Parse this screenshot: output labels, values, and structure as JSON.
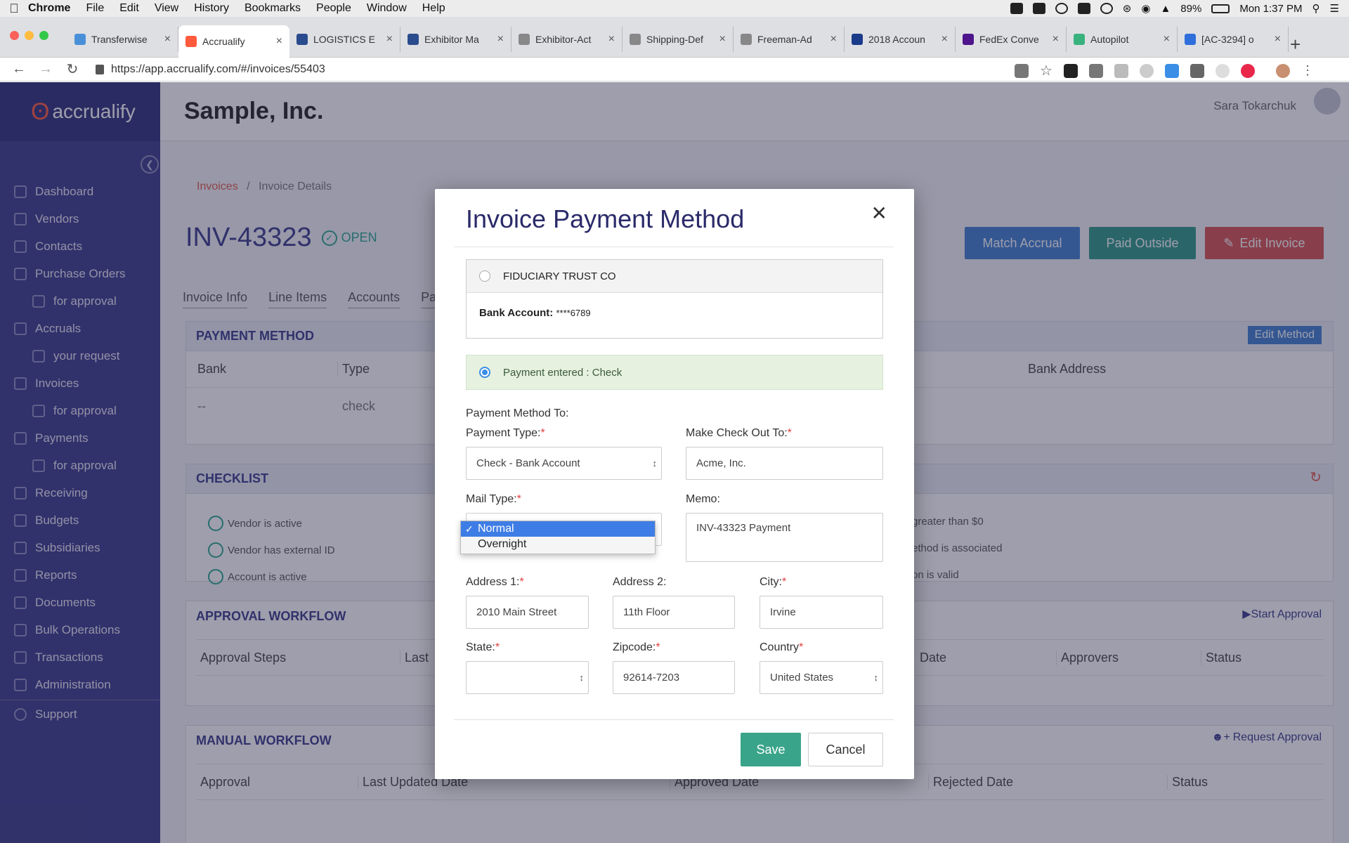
{
  "menubar": {
    "app": "Chrome",
    "items": [
      "File",
      "Edit",
      "View",
      "History",
      "Bookmarks",
      "People",
      "Window",
      "Help"
    ],
    "battery": "89%",
    "clock": "Mon 1:37 PM"
  },
  "browser": {
    "tabs": [
      {
        "title": "Transferwise",
        "color": "#4a90d9"
      },
      {
        "title": "Accrualify",
        "color": "#ff5a3c"
      },
      {
        "title": "LOGISTICS E",
        "color": "#2a4b8d"
      },
      {
        "title": "Exhibitor Ma",
        "color": "#2a4b8d"
      },
      {
        "title": "Exhibitor-Act",
        "color": "#888888"
      },
      {
        "title": "Shipping-Def",
        "color": "#888888"
      },
      {
        "title": "Freeman-Ad",
        "color": "#888888"
      },
      {
        "title": "2018 Accoun",
        "color": "#1a3a8a"
      },
      {
        "title": "FedEx Conve",
        "color": "#4d148c"
      },
      {
        "title": "Autopilot",
        "color": "#3ab27e"
      },
      {
        "title": "[AC-3294] o",
        "color": "#2e6fdb"
      }
    ],
    "url": "https://app.accrualify.com/#/invoices/55403"
  },
  "sidebar": {
    "logo": "accrualify",
    "items": [
      {
        "label": "Dashboard",
        "sub": false
      },
      {
        "label": "Vendors",
        "sub": false
      },
      {
        "label": "Contacts",
        "sub": false
      },
      {
        "label": "Purchase Orders",
        "sub": false
      },
      {
        "label": "for approval",
        "sub": true
      },
      {
        "label": "Accruals",
        "sub": false
      },
      {
        "label": "your request",
        "sub": true
      },
      {
        "label": "Invoices",
        "sub": false
      },
      {
        "label": "for approval",
        "sub": true
      },
      {
        "label": "Payments",
        "sub": false
      },
      {
        "label": "for approval",
        "sub": true
      },
      {
        "label": "Receiving",
        "sub": false
      },
      {
        "label": "Budgets",
        "sub": false
      },
      {
        "label": "Subsidiaries",
        "sub": false
      },
      {
        "label": "Reports",
        "sub": false
      },
      {
        "label": "Documents",
        "sub": false
      },
      {
        "label": "Bulk Operations",
        "sub": false
      },
      {
        "label": "Transactions",
        "sub": false
      },
      {
        "label": "Administration",
        "sub": false
      }
    ],
    "support": "Support"
  },
  "header": {
    "company": "Sample, Inc.",
    "user": "Sara Tokarchuk"
  },
  "page": {
    "breadcrumb_link": "Invoices",
    "breadcrumb_sep": "/",
    "breadcrumb_current": "Invoice Details",
    "invoice_number": "INV-43323",
    "status": "OPEN",
    "buttons": {
      "match_accrual": "Match Accrual",
      "paid_outside": "Paid Outside",
      "edit_invoice": "Edit Invoice"
    },
    "tabs": [
      "Invoice Info",
      "Line Items",
      "Accounts",
      "Pa"
    ],
    "payment_method": {
      "title": "PAYMENT METHOD",
      "edit": "Edit Method",
      "columns": {
        "bank": "Bank",
        "type": "Type",
        "bank_address": "Bank Address"
      },
      "row": {
        "bank": "--",
        "type": "check"
      }
    },
    "checklist": {
      "title": "CHECKLIST",
      "items_left": [
        "Vendor is active",
        "Vendor has external ID",
        "Account is active"
      ],
      "items_right": [
        "greater than $0",
        "ethod is associated",
        "on is valid"
      ]
    },
    "approval_workflow": {
      "title": "APPROVAL WORKFLOW",
      "action": "Start Approval",
      "columns": [
        "Approval Steps",
        "Last",
        "Date",
        "Approvers",
        "Status"
      ]
    },
    "manual_workflow": {
      "title": "MANUAL WORKFLOW",
      "action": "Request Approval",
      "columns": [
        "Approval",
        "Last Updated Date",
        "Approved Date",
        "Rejected Date",
        "Status"
      ]
    }
  },
  "modal": {
    "title": "Invoice Payment Method",
    "bank_name": "FIDUCIARY TRUST CO",
    "bank_account_label": "Bank Account:",
    "bank_account_value": "****6789",
    "payment_entered": "Payment entered : Check",
    "payment_method_to": "Payment Method To:",
    "fields": {
      "payment_type": {
        "label": "Payment Type:",
        "value": "Check - Bank Account"
      },
      "check_out_to": {
        "label": "Make Check Out To:",
        "value": "Acme, Inc."
      },
      "mail_type": {
        "label": "Mail Type:",
        "options": [
          "Normal",
          "Overnight"
        ],
        "selected": "Normal"
      },
      "memo": {
        "label": "Memo:",
        "value": "INV-43323 Payment"
      },
      "address1": {
        "label": "Address 1:",
        "value": "2010 Main Street"
      },
      "address2": {
        "label": "Address 2:",
        "value": "11th Floor"
      },
      "city": {
        "label": "City:",
        "value": "Irvine"
      },
      "state": {
        "label": "State:",
        "value": ""
      },
      "zipcode": {
        "label": "Zipcode:",
        "value": "92614-7203"
      },
      "country": {
        "label": "Country",
        "value": "United States"
      }
    },
    "save": "Save",
    "cancel": "Cancel"
  },
  "colors": {
    "sidebar": "#3a3a8a",
    "accent": "#3aa48a",
    "match_accrual": "#3f7fd0",
    "paid_outside": "#2d9a86",
    "edit_invoice": "#d9534f",
    "dropdown_selected": "#3f7de6"
  }
}
